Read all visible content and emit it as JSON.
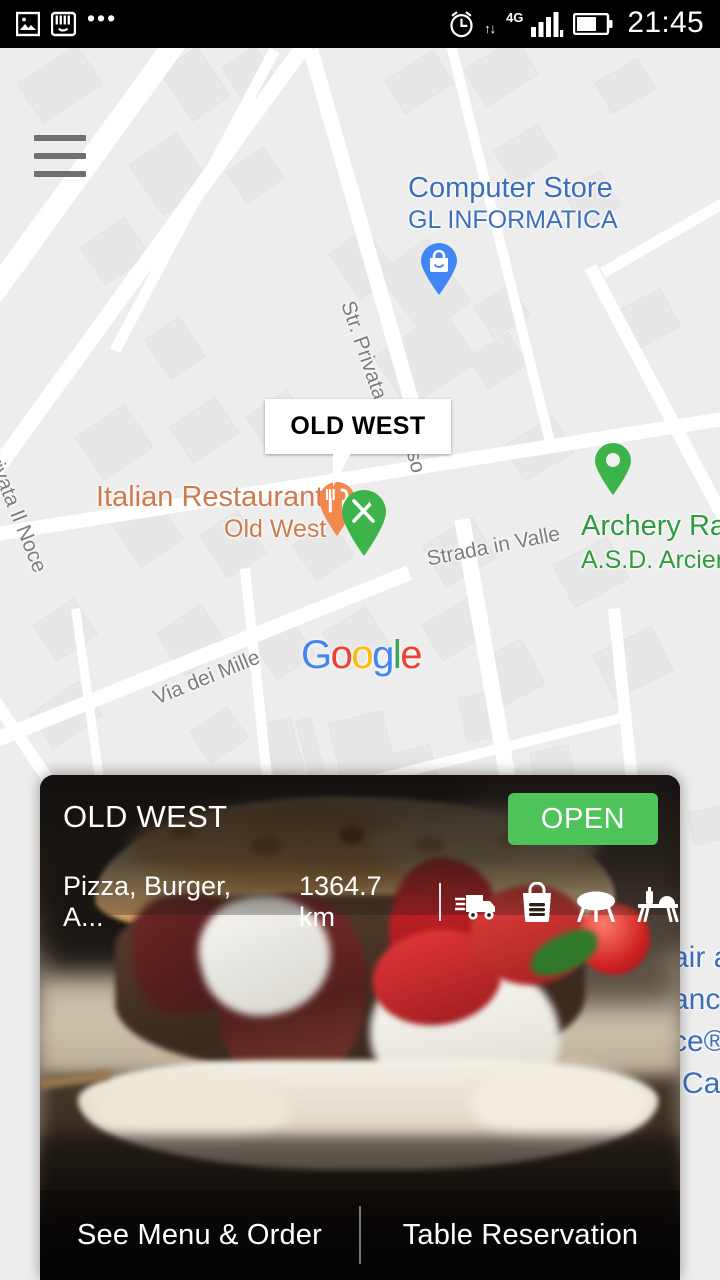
{
  "status_bar": {
    "icons_left": [
      "image-icon",
      "keyboard-icon",
      "more-dots-icon"
    ],
    "dots": "•••",
    "network_label": "4G",
    "icons_right": [
      "alarm-icon",
      "data-transfer-icon",
      "signal-icon",
      "battery-icon"
    ],
    "time": "21:45"
  },
  "map": {
    "menu_icon": "hamburger-menu-icon",
    "attribution": "Google",
    "google_letters": [
      {
        "ch": "G",
        "color": "#4285F4"
      },
      {
        "ch": "o",
        "color": "#EA4335"
      },
      {
        "ch": "o",
        "color": "#FBBC05"
      },
      {
        "ch": "g",
        "color": "#4285F4"
      },
      {
        "ch": "l",
        "color": "#34A853"
      },
      {
        "ch": "e",
        "color": "#EA4335"
      }
    ],
    "info_window": {
      "title": "OLD WEST"
    },
    "pois": [
      {
        "name": "Computer Store",
        "subtitle": "GL INFORMATICA",
        "color": "#3c6fbb",
        "pin": "shopping-bag-pin"
      },
      {
        "name": "Italian Restaurant",
        "subtitle": "Old West",
        "color": "#cd7a4e",
        "pin": "restaurant-pin"
      },
      {
        "name": "Archery Ran",
        "subtitle": "A.S.D. Arcieri C",
        "color": "#2e9b3f",
        "pin": "place-pin"
      }
    ],
    "poi_partial_right": [
      "air a",
      "anc",
      "ce®",
      "Car"
    ],
    "streets": [
      "Str. Privata Il Noce",
      "Str. Privata",
      "so",
      "Strada in Valle",
      "Via dei Mille"
    ]
  },
  "card": {
    "title": "OLD WEST",
    "status_badge": "OPEN",
    "cuisine": "Pizza, Burger, A...",
    "distance": "1364.7 km",
    "service_icons": [
      "delivery-truck-icon",
      "takeaway-bag-icon",
      "table-icon",
      "outdoor-dining-icon"
    ],
    "actions": [
      {
        "label": "See Menu & Order"
      },
      {
        "label": "Table Reservation"
      }
    ]
  },
  "colors": {
    "open_green": "#4ec45a",
    "map_bg": "#ededed",
    "road_white": "#ffffff",
    "poi_blue": "#3c6fbb",
    "poi_orange": "#cd7a4e",
    "poi_green": "#2e9b3f",
    "status_bar_bg": "#000000"
  }
}
